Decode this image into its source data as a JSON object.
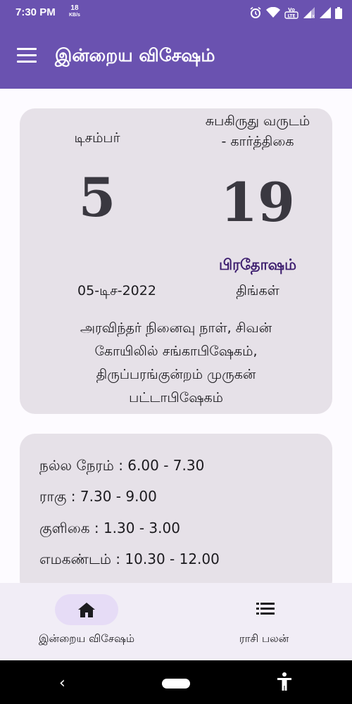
{
  "status_bar": {
    "time": "7:30 PM",
    "data_rate": "18",
    "data_unit": "KB/s",
    "volte": "Vo LTE",
    "icons": [
      "alarm-icon",
      "wifi-icon",
      "volte-icon",
      "signal-icon",
      "signal-icon",
      "battery-icon"
    ]
  },
  "app_bar": {
    "title": "இன்றைய விசேஷம்",
    "menu_icon": "hamburger-menu-icon"
  },
  "date_card": {
    "month": "டிசம்பர்",
    "day": "5",
    "tamil_year_line1": "சுபகிருது வருடம்",
    "tamil_year_line2": "- கார்த்திகை",
    "tamil_day": "19",
    "festival": "பிரதோஷம்",
    "full_date": "05-டிச-2022",
    "weekday": "திங்கள்",
    "events_lines": [
      "அரவிந்தர் நினைவு நாள், சிவன்",
      "கோயிலில் சங்காபிஷேகம்,",
      "திருப்பரங்குன்றம் முருகன்",
      "பட்டாபிஷேகம்"
    ]
  },
  "times_card": {
    "nalla_neram": "நல்ல நேரம் : 6.00 - 7.30",
    "ragu": "ராகு : 7.30 - 9.00",
    "kuligai": "குளிகை : 1.30 - 3.00",
    "emagandam": "எமகண்டம் : 10.30 - 12.00"
  },
  "bottom_nav": {
    "items": [
      {
        "label": "இன்றைய விசேஷம்",
        "icon": "home-icon",
        "active": true
      },
      {
        "label": "ராசி பலன்",
        "icon": "list-icon",
        "active": false
      }
    ]
  },
  "colors": {
    "primary": "#6a52b0",
    "card_bg": "#e6e1e8",
    "festival_text": "#3c1d6e",
    "nav_pill": "#e6dcf6"
  }
}
